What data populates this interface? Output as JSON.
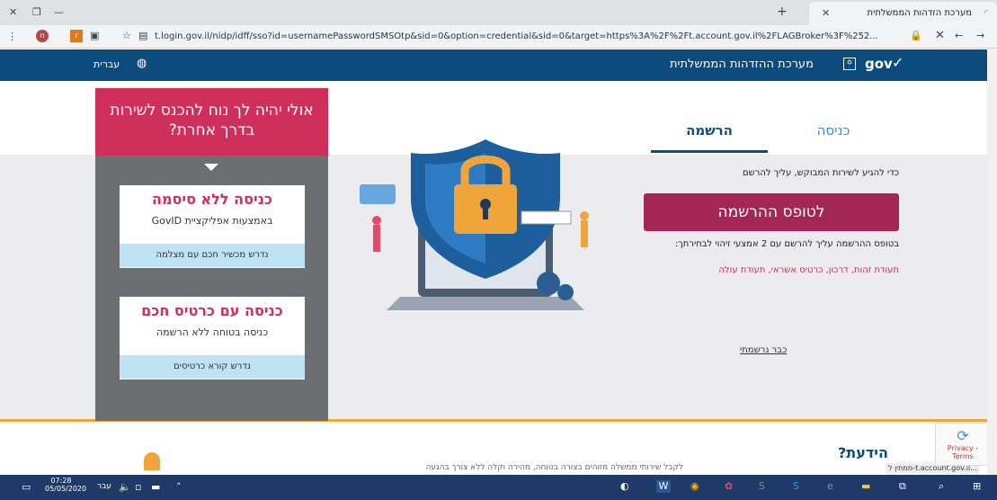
{
  "browser": {
    "tab_title": "מערכת הזדהות הממשלתית",
    "url": "t.login.gov.il/nidp/idff/sso?id=usernamePasswordSMSOtp&sid=0&option=credential&sid=0&target=https%3A%2F%2Ft.account.gov.il%2FLAGBroker%3F%252..."
  },
  "header": {
    "site_title": "מערכת ההזדהות הממשלתית",
    "logo": "gov",
    "language": "עברית"
  },
  "tabs": {
    "register": "הרשמה",
    "login": "כניסה"
  },
  "register": {
    "intro": "כדי להגיע לשירות המבוקש, עליך להרשם",
    "button": "לטופס ההרשמה",
    "info": "בטופס ההרשמה עליך להרשם עם 2 אמצעי זיהוי לבחירתך:",
    "options": "תעודת זהות, דרכון, כרטיס אשראי, תעודת עולה",
    "already": "כבר נרשמתי"
  },
  "side": {
    "title": "אולי יהיה לך נוח להכנס לשירות בדרך אחרת?",
    "card1": {
      "title": "כניסה ללא סיסמה",
      "sub": "באמצעות אפליקציית GovID",
      "foot": "נדרש מכשיר חכם עם מצלמה"
    },
    "card2": {
      "title": "כניסה עם כרטיס חכם",
      "sub": "כניסה בטוחה ללא הרשמה",
      "foot": "נדרש קורא כרטיסים"
    }
  },
  "bottom": {
    "didyouknow": "הידעת?",
    "text": "לקבל שירותי ממשלה מזוהים בצורה בטוחה, מהירה וקלה ללא צורך בהגעה",
    "status": "...t.account.gov.il-ממתין ל"
  },
  "recaptcha": {
    "text": "Privacy - Terms"
  },
  "taskbar": {
    "time": "07:28",
    "date": "05/05/2020",
    "lang": "עבר"
  }
}
